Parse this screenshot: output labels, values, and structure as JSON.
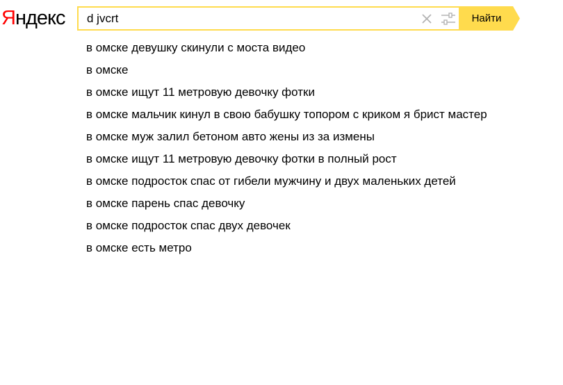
{
  "logo": {
    "first_letter": "Я",
    "rest": "ндекс"
  },
  "search": {
    "query": "d jvcrt",
    "clear_icon": "close-icon",
    "settings_icon": "sliders-icon",
    "button_label": "Найти",
    "accent_color": "#ffdb4d"
  },
  "suggestions": [
    "в омске девушку скинули с моста видео",
    "в омске",
    "в омске ищут 11 метровую девочку фотки",
    "в омске мальчик кинул в свою бабушку топором с криком я брист мастер",
    "в омске муж залил бетоном авто жены из за измены",
    "в омске ищут 11 метровую девочку фотки в полный рост",
    "в омске подросток спас от гибели мужчину и двух маленьких детей",
    "в омске парень спас девочку",
    "в омске подросток спас двух девочек",
    "в омске есть метро"
  ]
}
